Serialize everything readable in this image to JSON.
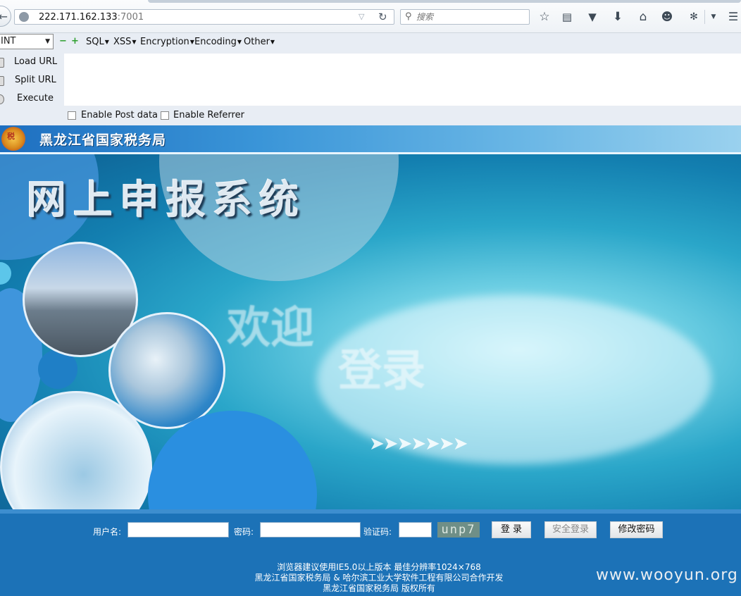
{
  "browser": {
    "url_host": "222.171.162.133",
    "url_port": ":7001",
    "search_placeholder": "搜索"
  },
  "hackbar": {
    "select_value": "INT",
    "menus": [
      "SQL",
      "XSS",
      "Encryption",
      "Encoding",
      "Other"
    ],
    "actions": [
      "Load URL",
      "Split URL",
      "Execute"
    ],
    "checkboxes": [
      "Enable Post data",
      "Enable Referrer"
    ]
  },
  "page": {
    "agency_title": "黑龙江省国家税务局",
    "emblem_text": "税",
    "system_title": "网上申报系统",
    "welcome_line1": "欢迎",
    "welcome_line2": "登录",
    "login": {
      "username_label": "用户名:",
      "password_label": "密码:",
      "captcha_label": "验证码:",
      "captcha_text": "unp7",
      "login_button": "登 录",
      "secure_login_button": "安全登录",
      "change_password_button": "修改密码"
    },
    "footer": {
      "line1": "浏览器建议使用IE5.0以上版本 最佳分辨率1024×768",
      "line2": "黑龙江省国家税务局 & 哈尔滨工业大学软件工程有限公司合作开发",
      "line3": "黑龙江省国家税务局 版权所有"
    }
  },
  "watermark": "www.wooyun.org",
  "colors": {
    "login_bar": "#1c72b7",
    "header_gradient_start": "#1e6fc0",
    "banner_deep": "#0d5f92",
    "hackbar_bg": "#e8edf4"
  }
}
